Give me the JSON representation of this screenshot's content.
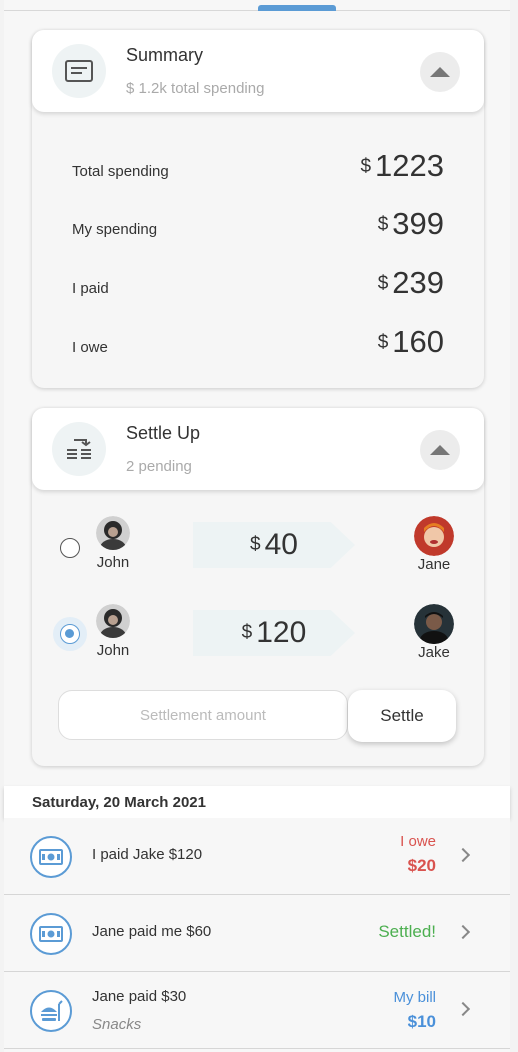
{
  "summary": {
    "title": "Summary",
    "subtitle": "$ 1.2k total spending",
    "currency": "$",
    "rows": [
      {
        "label": "Total spending",
        "value": "1223"
      },
      {
        "label": "My spending",
        "value": "399"
      },
      {
        "label": "I paid",
        "value": "239"
      },
      {
        "label": "I owe",
        "value": "160"
      }
    ]
  },
  "settle": {
    "title": "Settle Up",
    "subtitle": "2 pending",
    "currency": "$",
    "items": [
      {
        "from": "John",
        "to": "Jane",
        "amount": "40",
        "selected": false
      },
      {
        "from": "John",
        "to": "Jake",
        "amount": "120",
        "selected": true
      }
    ],
    "input_placeholder": "Settlement amount",
    "button_label": "Settle"
  },
  "date_header": "Saturday, 20 March 2021",
  "transactions": [
    {
      "description": "I paid Jake $120",
      "sub": "",
      "status": "I owe",
      "amount": "$20",
      "icon": "cash-icon",
      "status_color": "#d9534f"
    },
    {
      "description": "Jane paid me $60",
      "sub": "",
      "status": "Settled!",
      "amount": "",
      "icon": "cash-icon",
      "status_color": "#4caf50"
    },
    {
      "description": "Jane paid $30",
      "sub": "Snacks",
      "status": "My bill",
      "amount": "$10",
      "icon": "food-icon",
      "status_color": "#4a90d9"
    }
  ],
  "colors": {
    "accent": "#5b9bd5",
    "owe": "#d9534f",
    "settled": "#4caf50",
    "bill": "#4a90d9"
  }
}
